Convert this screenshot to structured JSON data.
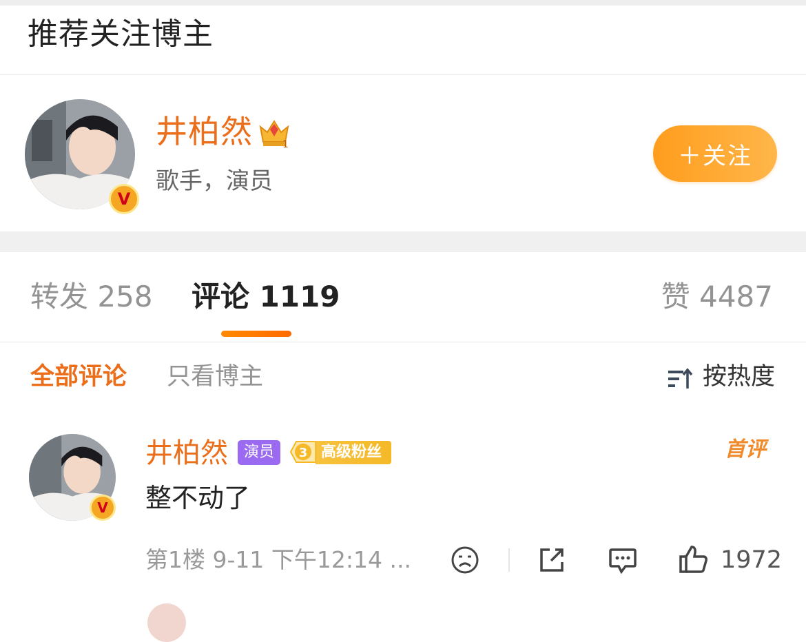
{
  "recommend": {
    "section_title": "推荐关注博主",
    "name": "井柏然",
    "description": "歌手，演员",
    "follow_button": "＋关注",
    "crown_level": "1"
  },
  "tabs": {
    "repost": "转发 258",
    "comment": "评论 1119",
    "like": "赞 4487"
  },
  "filters": {
    "all": "全部评论",
    "blogger_only": "只看博主",
    "sort": "按热度"
  },
  "comment": {
    "author": "井柏然",
    "tag": "演员",
    "fan_level": "3",
    "fan_label": "高级粉丝",
    "first_mark": "首评",
    "text": "整不动了",
    "meta": "第1楼 9-11 下午12:14 ...",
    "likes": "1972"
  },
  "colors": {
    "accent": "#eb6e1a",
    "follow_gradient_start": "#ff9d1d",
    "tag_actor": "#9a6bf0"
  },
  "icons": [
    "verified-v-icon",
    "crown-icon",
    "sort-icon",
    "dislike-face-icon",
    "share-icon",
    "comment-icon",
    "like-thumb-icon"
  ]
}
